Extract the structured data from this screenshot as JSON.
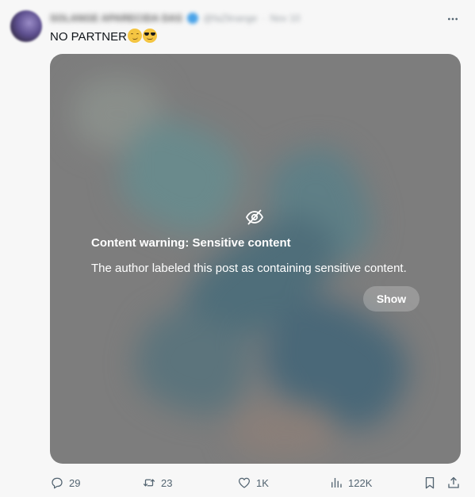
{
  "author": {
    "name": "SOLANGE APARECIDA DAS",
    "handle": "@faZlinange",
    "separator": "·",
    "date": "Nov 10"
  },
  "post": {
    "text": "NO PARTNER",
    "emojis": [
      "smirking-face",
      "smiling-face-with-sunglasses"
    ]
  },
  "media": {
    "warning_title": "Content warning: Sensitive content",
    "warning_body": "The author labeled this post as containing sensitive content.",
    "show_label": "Show"
  },
  "actions": {
    "replies": "29",
    "reposts": "23",
    "likes": "1K",
    "views": "122K"
  },
  "colors": {
    "accent": "#1d9bf0",
    "action_gray": "#536471",
    "background": "#f7f7f7"
  }
}
